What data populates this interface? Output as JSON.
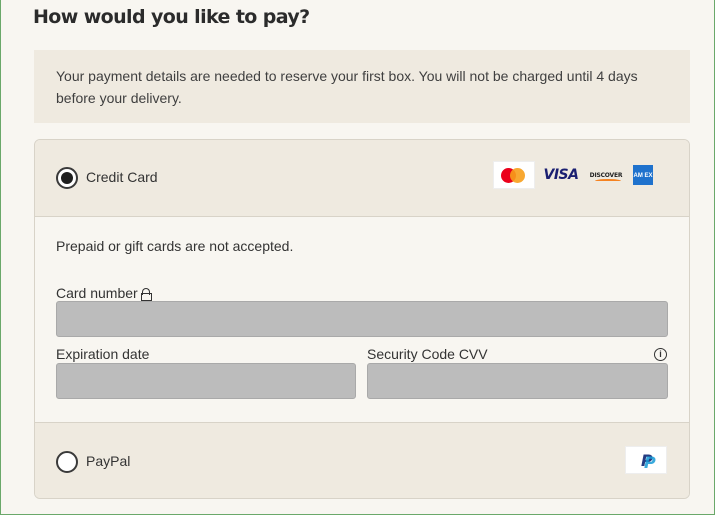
{
  "page": {
    "heading": "How would you like to pay?",
    "notice": "Your payment details are needed to reserve your first box. You will not be charged until 4 days before your delivery."
  },
  "credit_card": {
    "label": "Credit Card",
    "selected": true,
    "logos": [
      "mastercard",
      "visa",
      "discover",
      "amex"
    ],
    "visa_text": "VISA",
    "discover_text": "DISCOVER",
    "amex_text": "AM EX",
    "note": "Prepaid or gift cards are not accepted.",
    "card_number_label": "Card number",
    "card_number_value": "",
    "expiration_label": "Expiration date",
    "expiration_value": "",
    "cvv_label": "Security Code CVV",
    "cvv_value": ""
  },
  "paypal": {
    "label": "PayPal",
    "selected": false,
    "logo": "paypal"
  },
  "colors": {
    "page_bg": "#f8f6f1",
    "panel_bg": "#efeae0",
    "input_bg": "#bcbcbc",
    "border": "#d8d3c8"
  }
}
